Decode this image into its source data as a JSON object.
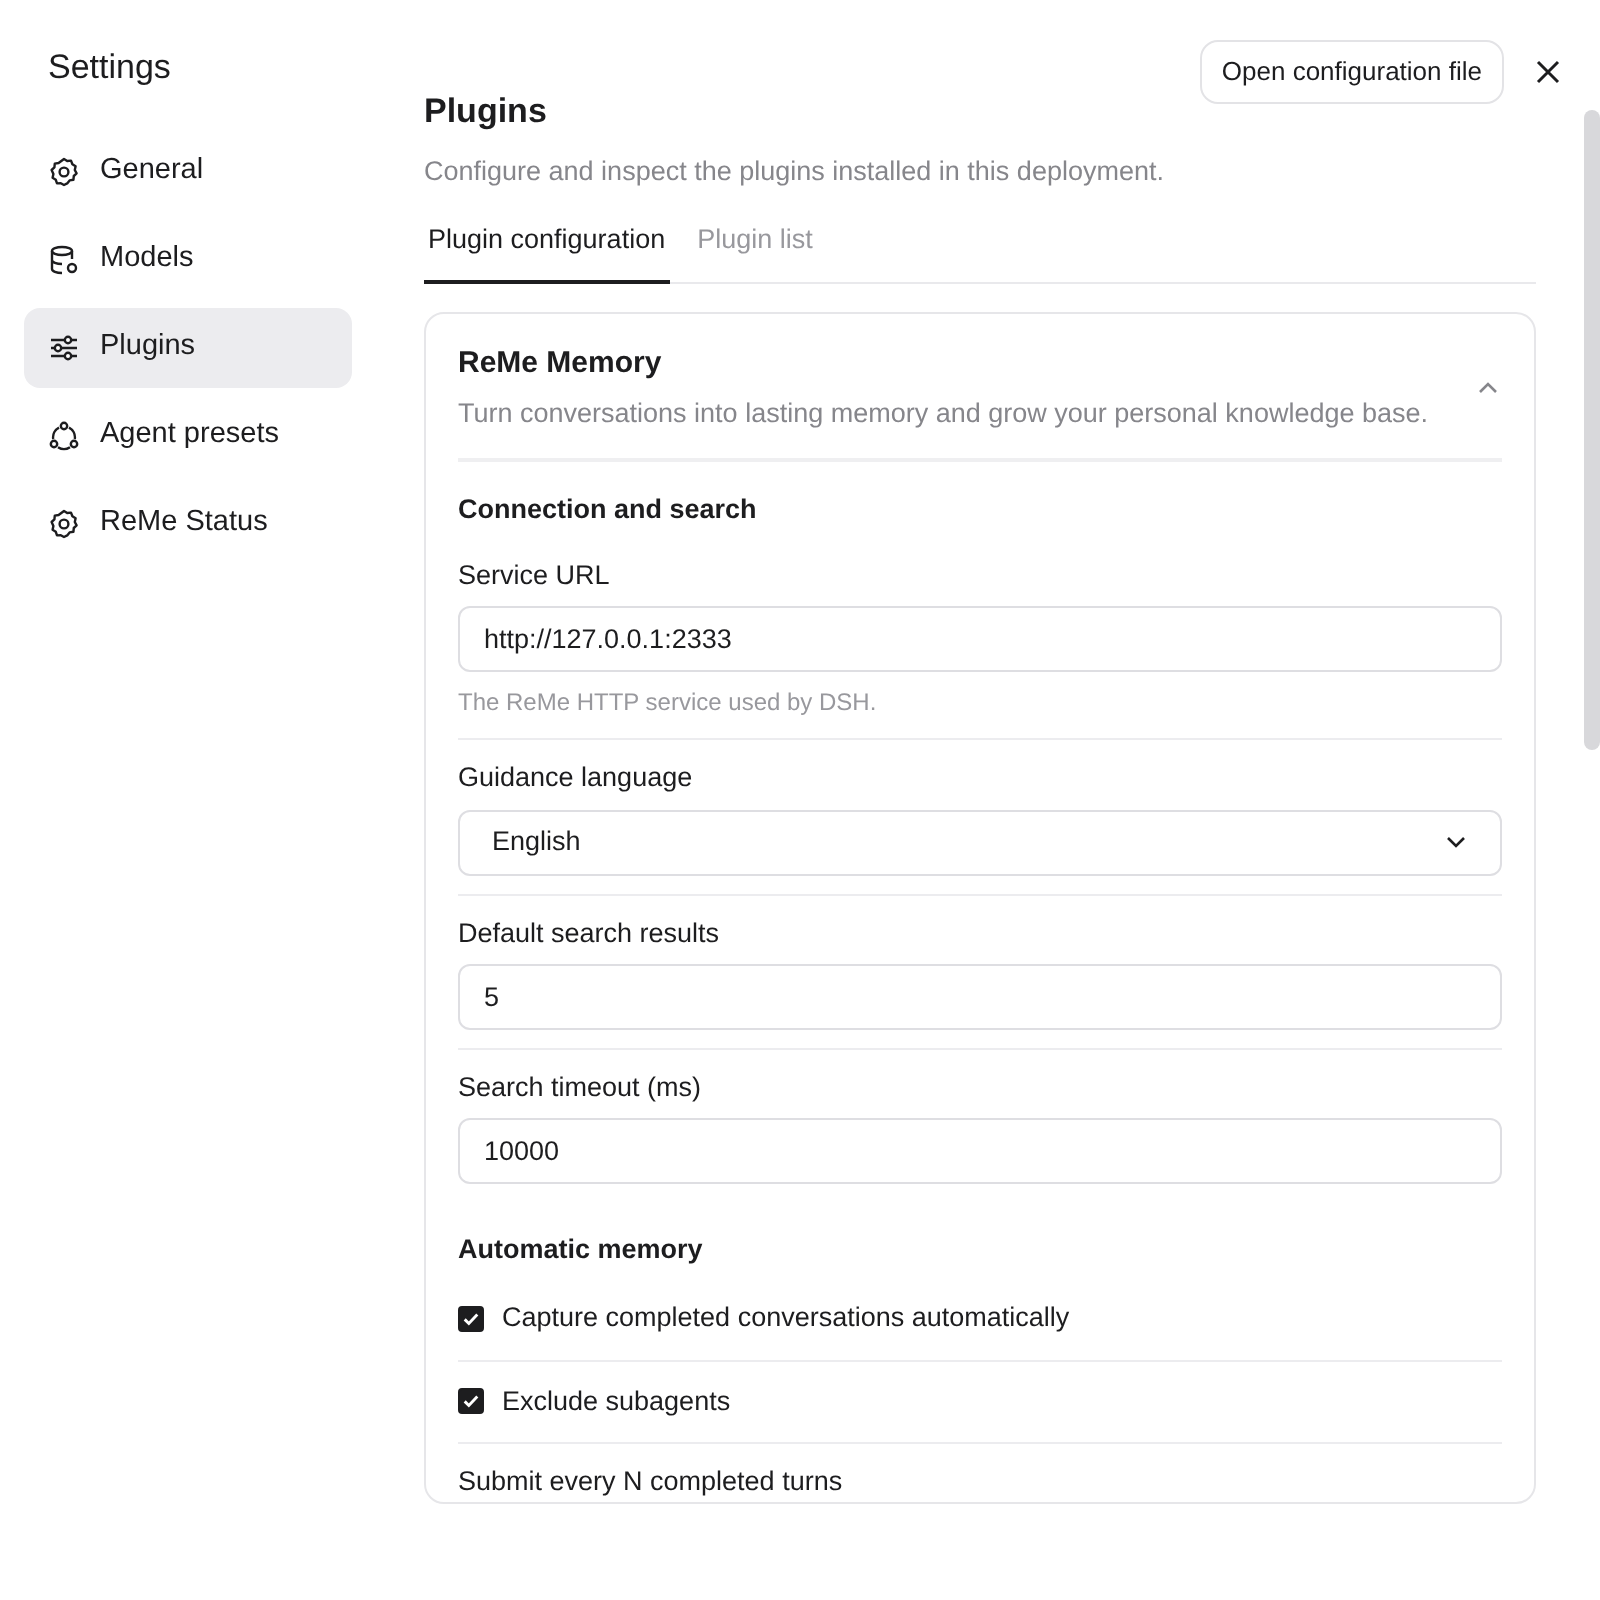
{
  "window": {
    "title": "Settings",
    "action_button": "Open configuration file"
  },
  "sidebar": {
    "items": [
      {
        "label": "General",
        "selected": false
      },
      {
        "label": "Models",
        "selected": false
      },
      {
        "label": "Plugins",
        "selected": true
      },
      {
        "label": "Agent presets",
        "selected": false
      },
      {
        "label": "ReMe Status",
        "selected": false
      }
    ]
  },
  "page": {
    "title": "Plugins",
    "description": "Configure and inspect the plugins installed in this deployment."
  },
  "tabs": [
    {
      "label": "Plugin configuration",
      "selected": true
    },
    {
      "label": "Plugin list",
      "selected": false
    }
  ],
  "plugin_card": {
    "title": "ReMe Memory",
    "description": "Turn conversations into lasting memory and grow your personal knowledge base.",
    "expanded": true,
    "items": [
      {
        "kind": "heading",
        "label": "Connection and search"
      },
      {
        "kind": "input",
        "label": "Service URL",
        "value": "http://127.0.0.1:2333",
        "help": "The ReMe HTTP service used by DSH."
      },
      {
        "kind": "select",
        "label": "Guidance language",
        "value": "English"
      },
      {
        "kind": "input",
        "label": "Default search results",
        "value": "5"
      },
      {
        "kind": "input",
        "label": "Search timeout (ms)",
        "value": "10000"
      },
      {
        "kind": "heading",
        "label": "Automatic memory"
      },
      {
        "kind": "checkbox",
        "label": "Capture completed conversations automatically",
        "checked": true
      },
      {
        "kind": "checkbox",
        "label": "Exclude subagents",
        "checked": true
      },
      {
        "kind": "label",
        "label": "Submit every N completed turns"
      }
    ]
  }
}
